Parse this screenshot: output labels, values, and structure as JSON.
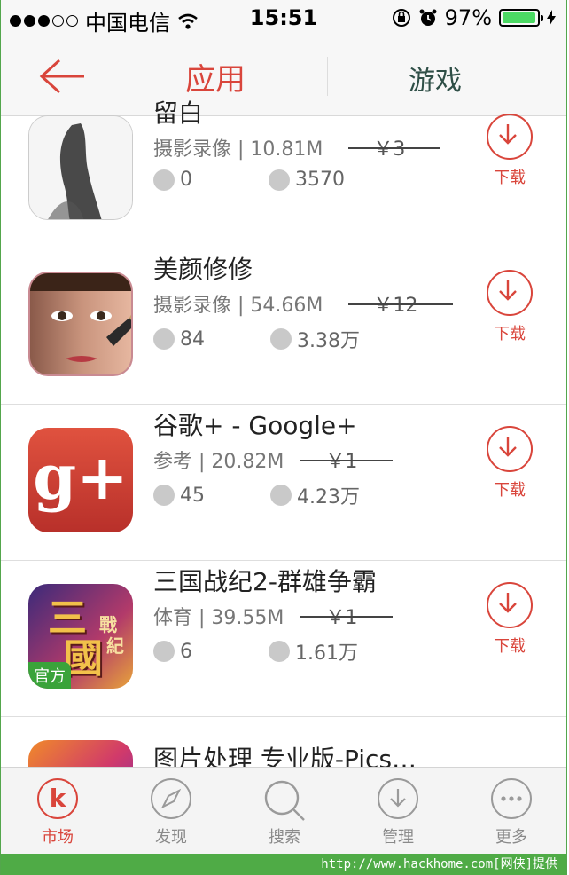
{
  "status_bar": {
    "carrier": "中国电信",
    "time": "15:51",
    "battery": "97%",
    "battery_level": 0.97
  },
  "nav": {
    "active_tab": "应用",
    "other_tab": "游戏"
  },
  "apps": [
    {
      "name": "留白",
      "category_size": "摄影录像 | 10.81M",
      "price": "￥3",
      "likes": "0",
      "downloads": "3570",
      "download_label": "下载"
    },
    {
      "name": "美颜修修",
      "category_size": "摄影录像 | 54.66M",
      "price": "￥12",
      "likes": "84",
      "downloads": "3.38万",
      "download_label": "下载"
    },
    {
      "name": "谷歌+ - Google+",
      "category_size": "参考 | 20.82M",
      "price": "￥1",
      "likes": "45",
      "downloads": "4.23万",
      "download_label": "下载"
    },
    {
      "name": "三国战纪2-群雄争霸",
      "category_size": "体育 | 39.55M",
      "price": "￥1",
      "likes": "6",
      "downloads": "1.61万",
      "download_label": "下载",
      "badge": "官方"
    },
    {
      "name": "图片处理 专业版-Pics…",
      "category_size": "",
      "price": "",
      "likes": "",
      "downloads": "",
      "download_label": ""
    }
  ],
  "app_icon_text": {
    "google_plus": "g+",
    "sanguo_line1": "三",
    "sanguo_line2": "國",
    "sanguo_side1": "戰",
    "sanguo_side2": "紀"
  },
  "tabbar": {
    "market": "市场",
    "discover": "发现",
    "search": "搜索",
    "manage": "管理",
    "more": "更多",
    "market_icon_letter": "k"
  },
  "footer": "http://www.hackhome.com[网侠]提供",
  "colors": {
    "accent": "#d9453b",
    "green_border": "#4fab46"
  }
}
